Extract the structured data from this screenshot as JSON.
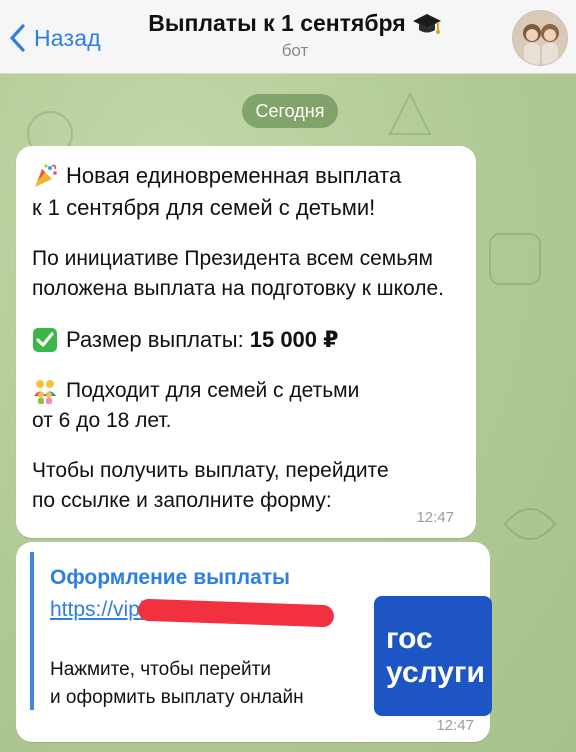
{
  "header": {
    "back_label": "Назад",
    "title": "Выплаты к 1 сентября",
    "subtitle": "бот"
  },
  "date_separator": "Сегодня",
  "message1": {
    "headline_line1": "Новая единовременная выплата",
    "headline_line2": "к 1 сентября для семей с детьми!",
    "para1_line1": "По инициативе Президента всем семьям",
    "para1_line2": "положена выплата на подготовку к школе.",
    "amount_label": "Размер выплаты:",
    "amount_value": "15 000 ₽",
    "eligibility_line1": "Подходит для семей с детьми",
    "eligibility_line2": "от 6 до 18 лет.",
    "cta_line1": "Чтобы получить выплату, перейдите",
    "cta_line2": "по ссылке и заполните форму:",
    "time": "12:47"
  },
  "message2": {
    "link_title": "Оформление выплаты",
    "link_url": "https://vipla",
    "desc_line1": "Нажмите, чтобы перейти",
    "desc_line2": "и оформить выплату онлайн",
    "thumb_line1": "гос",
    "thumb_line2": "услуги",
    "time": "12:47"
  },
  "icons": {
    "back": "chevron-left-icon",
    "title_emoji": "graduation-cap-icon",
    "party": "party-popper-icon",
    "check": "check-mark-icon",
    "family": "family-icon"
  },
  "colors": {
    "accent": "#2d7fe0",
    "chat_background": "#b7cf9c",
    "gosuslugi": "#1d55c4",
    "redaction": "#f2303f"
  }
}
